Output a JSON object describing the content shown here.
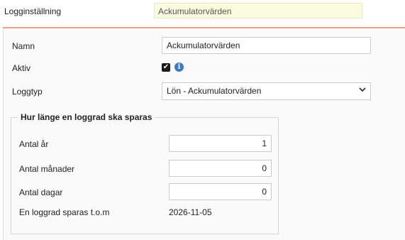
{
  "header": {
    "label": "Logginställning",
    "value": "Ackumulatorvärden"
  },
  "form": {
    "name_label": "Namn",
    "name_value": "Ackumulatorvärden",
    "active_label": "Aktiv",
    "active_checked": true,
    "logtype_label": "Loggtyp",
    "logtype_value": "Lön - Ackumulatorvärden"
  },
  "retention": {
    "legend": "Hur länge en loggrad ska sparas",
    "years_label": "Antal år",
    "years_value": "1",
    "months_label": "Antal månader",
    "months_value": "0",
    "days_label": "Antal dagar",
    "days_value": "0",
    "saved_until_label": "En loggrad sparas t.o.m",
    "saved_until_value": "2026-11-05"
  },
  "icons": {
    "checkbox": "checkmark-icon",
    "info": "info-icon",
    "dropdown": "chevron-down-icon"
  },
  "colors": {
    "accent": "#e8a38a",
    "header_field_bg": "#fbfbe0",
    "info_icon": "#3b7bbf"
  }
}
